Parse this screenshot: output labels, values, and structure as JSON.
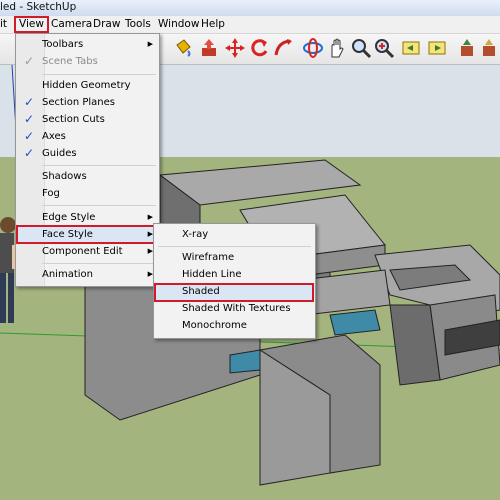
{
  "window": {
    "title": "led - SketchUp"
  },
  "menubar": {
    "items": [
      {
        "label": "it"
      },
      {
        "label": "View"
      },
      {
        "label": "Camera"
      },
      {
        "label": "Draw"
      },
      {
        "label": "Tools"
      },
      {
        "label": "Window"
      },
      {
        "label": "Help"
      }
    ]
  },
  "view_menu": {
    "items": [
      {
        "label": "Toolbars",
        "checked": false,
        "submenu": true,
        "disabled": false
      },
      {
        "label": "Scene Tabs",
        "checked": true,
        "submenu": false,
        "disabled": true
      },
      {
        "label": "Hidden Geometry",
        "checked": false,
        "submenu": false,
        "disabled": false
      },
      {
        "label": "Section Planes",
        "checked": true,
        "submenu": false,
        "disabled": false
      },
      {
        "label": "Section Cuts",
        "checked": true,
        "submenu": false,
        "disabled": false
      },
      {
        "label": "Axes",
        "checked": true,
        "submenu": false,
        "disabled": false
      },
      {
        "label": "Guides",
        "checked": true,
        "submenu": false,
        "disabled": false
      },
      {
        "label": "Shadows",
        "checked": false,
        "submenu": false,
        "disabled": false
      },
      {
        "label": "Fog",
        "checked": false,
        "submenu": false,
        "disabled": false
      },
      {
        "label": "Edge Style",
        "checked": false,
        "submenu": true,
        "disabled": false
      },
      {
        "label": "Face Style",
        "checked": false,
        "submenu": true,
        "disabled": false
      },
      {
        "label": "Component Edit",
        "checked": false,
        "submenu": true,
        "disabled": false
      },
      {
        "label": "Animation",
        "checked": false,
        "submenu": true,
        "disabled": false
      }
    ]
  },
  "face_style_menu": {
    "items": [
      {
        "label": "X-ray"
      },
      {
        "label": "Wireframe"
      },
      {
        "label": "Hidden Line"
      },
      {
        "label": "Shaded"
      },
      {
        "label": "Shaded With Textures"
      },
      {
        "label": "Monochrome"
      }
    ]
  },
  "toolbar": {
    "icons": [
      "pencil-icon",
      "arc-icon",
      "paint-bucket-icon",
      "push-pull-icon",
      "move-icon",
      "rotate-icon",
      "follow-me-icon",
      "orbit-icon",
      "pan-icon",
      "zoom-icon",
      "zoom-extents-icon",
      "previous-view-icon",
      "next-view-icon",
      "get-models-icon",
      "share-model-icon",
      "components-icon"
    ]
  },
  "colors": {
    "sky": "#d8e2ea",
    "ground": "#a3b57f",
    "highlight": "#d11a2a",
    "check": "#1a4fc9",
    "model_face": "#8c8c8c"
  }
}
